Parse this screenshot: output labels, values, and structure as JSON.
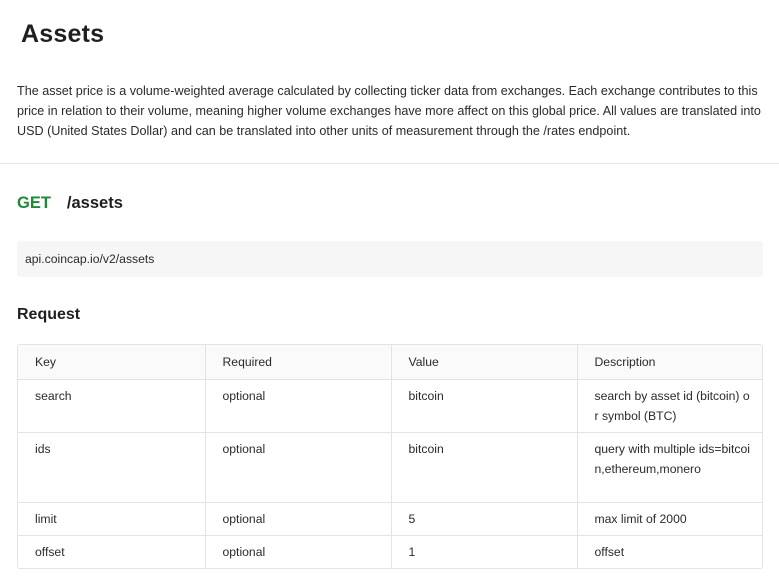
{
  "page": {
    "title": "Assets",
    "intro": "The asset price is a volume-weighted average calculated by collecting ticker data from exchanges. Each exchange contributes to this price in relation to their volume, meaning higher volume exchanges have more affect on this global price. All values are translated into USD (United States Dollar) and can be translated into other units of measurement through the /rates endpoint."
  },
  "endpoint": {
    "method": "GET",
    "path": "/assets",
    "url": "api.coincap.io/v2/assets"
  },
  "request": {
    "heading": "Request",
    "columns": [
      "Key",
      "Required",
      "Value",
      "Description"
    ],
    "rows": [
      [
        "search",
        "optional",
        "bitcoin",
        "search by asset id (bitcoin) or symbol (BTC)"
      ],
      [
        "ids",
        "optional",
        "bitcoin",
        "query with multiple ids=bitcoin,ethereum,monero"
      ],
      [
        "limit",
        "optional",
        "5",
        "max limit of 2000"
      ],
      [
        "offset",
        "optional",
        "1",
        "offset"
      ]
    ]
  },
  "colors": {
    "method_green": "#1e8a3a",
    "code_background": "#f6f6f6",
    "border": "#e3e3e3"
  }
}
